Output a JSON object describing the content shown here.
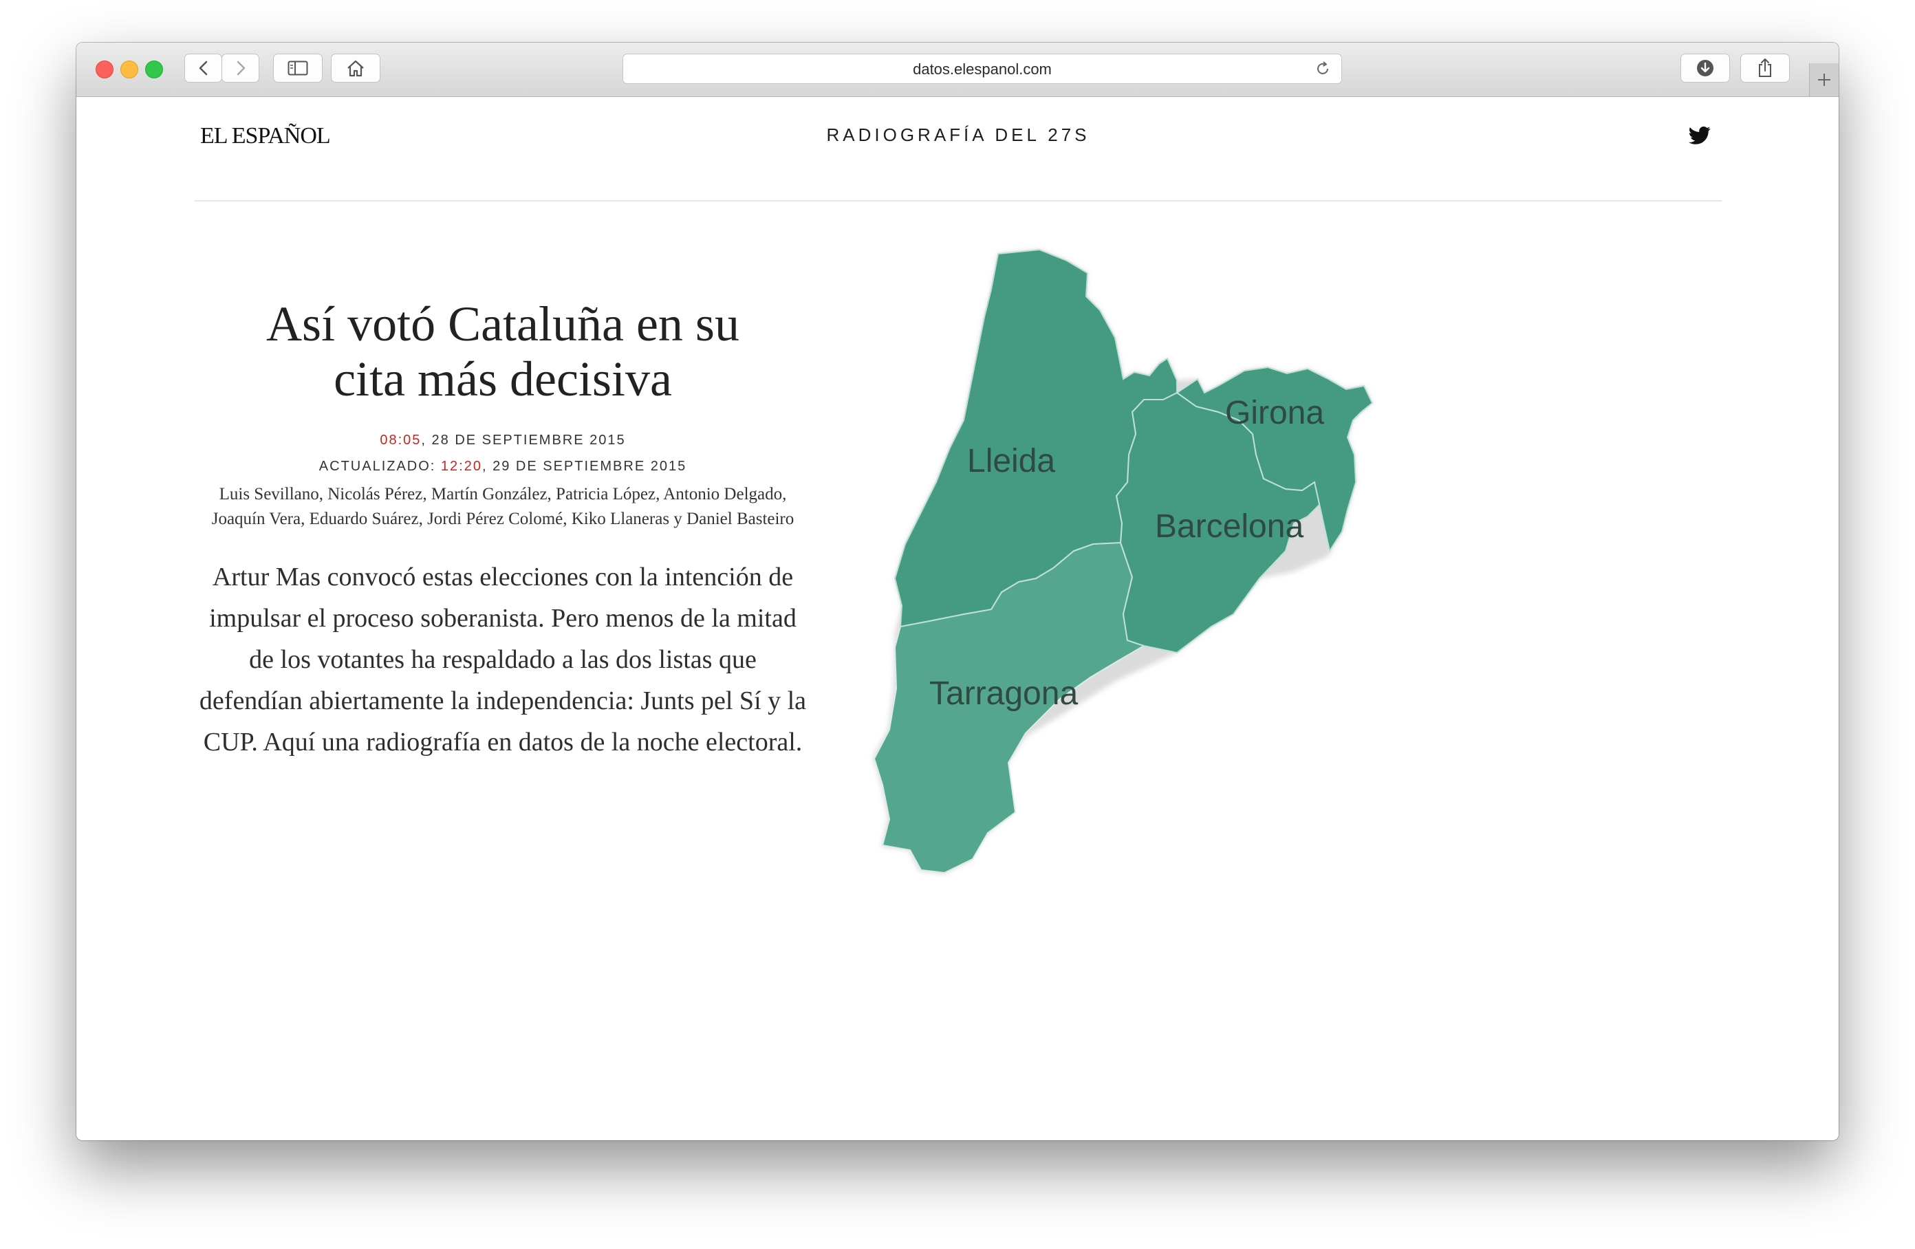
{
  "browser": {
    "url": "datos.elespanol.com",
    "buttons": {
      "back": "back",
      "forward": "forward",
      "sidebar": "sidebar",
      "home": "home",
      "downloads": "downloads",
      "share": "share",
      "new_tab": "new tab"
    }
  },
  "site": {
    "logo": "EL ESPAÑOL",
    "section_title": "RADIOGRAFÍA DEL 27S",
    "social_icon": "twitter-icon"
  },
  "article": {
    "headline_line1": "Así votó Cataluña en su",
    "headline_line2": "cita más decisiva",
    "published_time": "08:05",
    "published_date": ", 28 DE SEPTIEMBRE 2015",
    "updated_label": "ACTUALIZADO: ",
    "updated_time": "12:20",
    "updated_date": ", 29 DE SEPTIEMBRE 2015",
    "authors": "Luis Sevillano, Nicolás Pérez, Martín González, Patricia López, Antonio Delgado, Joaquín Vera, Eduardo Suárez, Jordi Pérez Colomé, Kiko Llaneras y Daniel Basteiro",
    "lead": "Artur Mas convocó estas elecciones con la intención de impulsar el proceso soberanista. Pero menos de la mitad de los votantes ha respaldado a las dos listas que defendían abiertamente la independencia: Junts pel Sí y la CUP. Aquí una radiografía en datos de la noche electoral."
  },
  "map": {
    "regions": [
      {
        "name": "Lleida",
        "color": "#449b82"
      },
      {
        "name": "Girona",
        "color": "#449b82"
      },
      {
        "name": "Barcelona",
        "color": "#449b82"
      },
      {
        "name": "Tarragona",
        "color": "#55a68e"
      }
    ],
    "accent_color": "#c5271f"
  }
}
